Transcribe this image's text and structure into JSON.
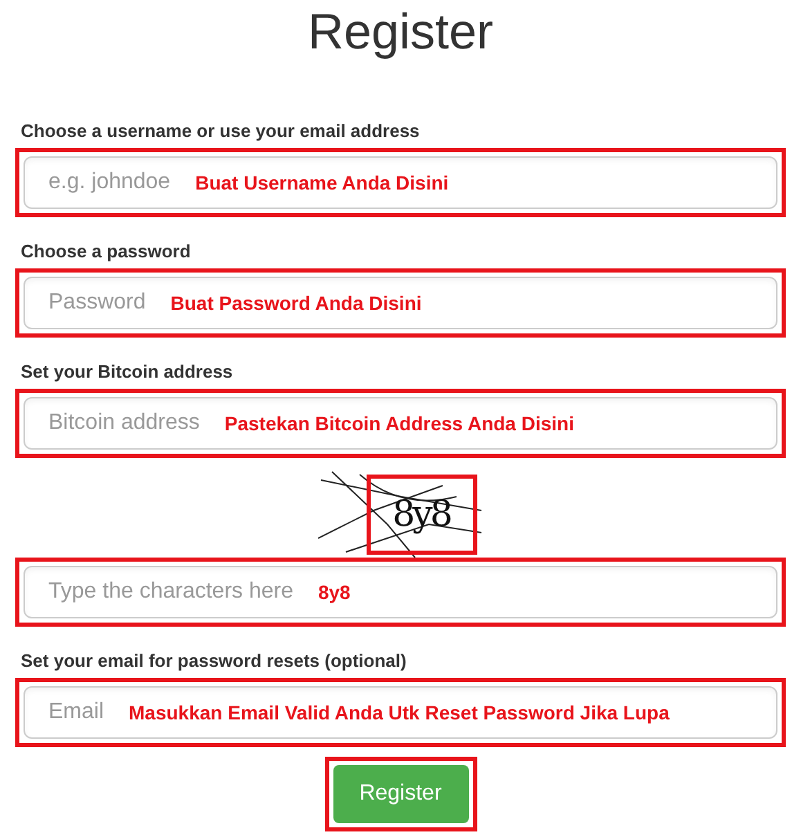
{
  "title": "Register",
  "items": [
    {
      "kind": "field",
      "label": "Choose a username or use your email address",
      "placeholder": "e.g. johndoe",
      "annotation": "Buat Username Anda Disini"
    },
    {
      "kind": "field",
      "label": "Choose a password",
      "placeholder": "Password",
      "annotation": "Buat Password Anda Disini"
    },
    {
      "kind": "field",
      "label": "Set your Bitcoin address",
      "placeholder": "Bitcoin address",
      "annotation": "Pastekan Bitcoin Address Anda Disini"
    },
    {
      "kind": "captcha",
      "text": "8y8"
    },
    {
      "kind": "field",
      "placeholder": "Type the characters here",
      "annotation": "8y8"
    },
    {
      "kind": "field",
      "label": "Set your email for password resets (optional)",
      "placeholder": "Email",
      "annotation": "Masukkan Email Valid Anda Utk Reset Password Jika Lupa"
    }
  ],
  "button": "Register"
}
